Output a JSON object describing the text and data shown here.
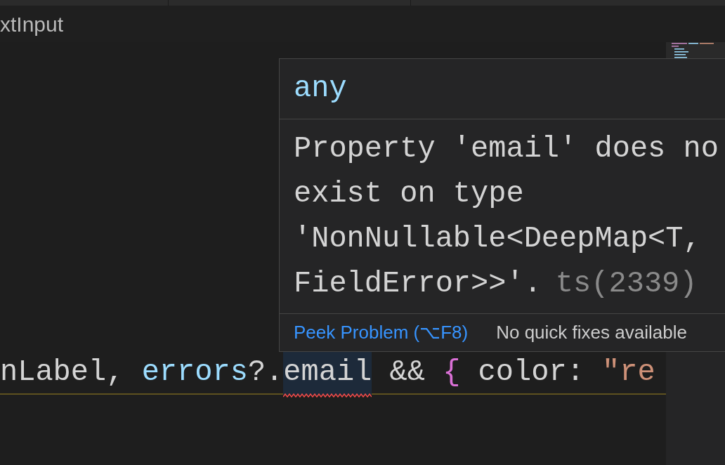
{
  "breadcrumb": {
    "text": "xtInput"
  },
  "code_line": {
    "tokens": [
      {
        "kind": "plain",
        "text": "nLabel, ",
        "problem": false
      },
      {
        "kind": "variable",
        "text": "errors",
        "problem": false
      },
      {
        "kind": "plain",
        "text": "?.",
        "problem": false
      },
      {
        "kind": "plain",
        "text": "email",
        "problem": true
      },
      {
        "kind": "plain",
        "text": " && ",
        "problem": false
      },
      {
        "kind": "bracket",
        "text": "{",
        "problem": false
      },
      {
        "kind": "plain",
        "text": " color: ",
        "problem": false
      },
      {
        "kind": "string",
        "text": "\"re",
        "problem": false
      }
    ]
  },
  "hover": {
    "type": "any",
    "message_lines": [
      "Property 'email' does no",
      "exist on type",
      "'NonNullable<DeepMap<T,",
      "FieldError>>'."
    ],
    "source": "ts(2339)",
    "actions": [
      {
        "kind": "link",
        "label": "Peek Problem (⌥F8)"
      },
      {
        "kind": "status",
        "label": "No quick fixes available"
      }
    ]
  }
}
